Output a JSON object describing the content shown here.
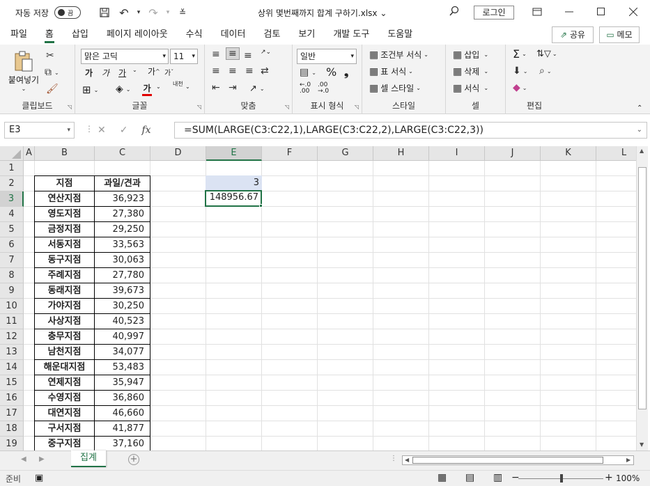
{
  "titlebar": {
    "autosave_label": "자동 저장",
    "autosave_state": "끔",
    "document_title": "상위 몇번째까지 합계 구하기.xlsx",
    "title_dropdown": "⌄",
    "login_label": "로그인"
  },
  "menu": {
    "tabs": [
      "파일",
      "홈",
      "삽입",
      "페이지 레이아웃",
      "수식",
      "데이터",
      "검토",
      "보기",
      "개발 도구",
      "도움말"
    ],
    "active": "홈",
    "share_label": "공유",
    "memo_label": "메모"
  },
  "ribbon": {
    "clipboard": {
      "paste_label": "붙여넣기",
      "group_label": "클립보드"
    },
    "font": {
      "font_name": "맑은 고딕",
      "font_size": "11",
      "bold": "가",
      "italic": "가",
      "underline": "가",
      "grow": "가",
      "shrink": "가",
      "phonetic": "내천",
      "font_color_glyph": "가",
      "group_label": "글꼴"
    },
    "alignment": {
      "group_label": "맞춤"
    },
    "number": {
      "format": "일반",
      "percent": "%",
      "comma": "❟",
      "group_label": "표시 형식"
    },
    "styles": {
      "conditional": "조건부 서식",
      "table": "표 서식",
      "cell_style": "셀 스타일",
      "group_label": "스타일"
    },
    "cells": {
      "insert": "삽입",
      "delete": "삭제",
      "format": "서식",
      "group_label": "셀"
    },
    "editing": {
      "group_label": "편집"
    },
    "accent_color": "#217346",
    "font_color": "#e00000"
  },
  "formulabar": {
    "name_box": "E3",
    "fx": "fx",
    "formula": "=SUM(LARGE(C3:C22,1),LARGE(C3:C22,2),LARGE(C3:C22,3))"
  },
  "grid": {
    "columns": [
      "A",
      "B",
      "C",
      "D",
      "E",
      "F",
      "G",
      "H",
      "I",
      "J",
      "K",
      "L"
    ],
    "rows": [
      "1",
      "2",
      "3",
      "4",
      "5",
      "6",
      "7",
      "8",
      "9",
      "10",
      "11",
      "12",
      "13",
      "14",
      "15",
      "16",
      "17",
      "18",
      "19"
    ],
    "selected_column": "E",
    "selected_row": "3",
    "table_headers": [
      "지점",
      "과일/견과"
    ],
    "table_rows": [
      [
        "연산지점",
        "36,923"
      ],
      [
        "영도지점",
        "27,380"
      ],
      [
        "금정지점",
        "29,250"
      ],
      [
        "서동지점",
        "33,563"
      ],
      [
        "동구지점",
        "30,063"
      ],
      [
        "주례지점",
        "27,780"
      ],
      [
        "동래지점",
        "39,673"
      ],
      [
        "가야지점",
        "30,250"
      ],
      [
        "사상지점",
        "40,523"
      ],
      [
        "충무지점",
        "40,997"
      ],
      [
        "남천지점",
        "34,077"
      ],
      [
        "해운대지점",
        "53,483"
      ],
      [
        "연제지점",
        "35,947"
      ],
      [
        "수영지점",
        "36,860"
      ],
      [
        "대연지점",
        "46,660"
      ],
      [
        "구서지점",
        "41,877"
      ],
      [
        "중구지점",
        "37,160"
      ]
    ],
    "e2_value": "3",
    "e3_value": "148956.67"
  },
  "sheets": {
    "tabs": [
      "집계"
    ],
    "active": "집계"
  },
  "status": {
    "ready": "준비",
    "zoom": "100%"
  }
}
